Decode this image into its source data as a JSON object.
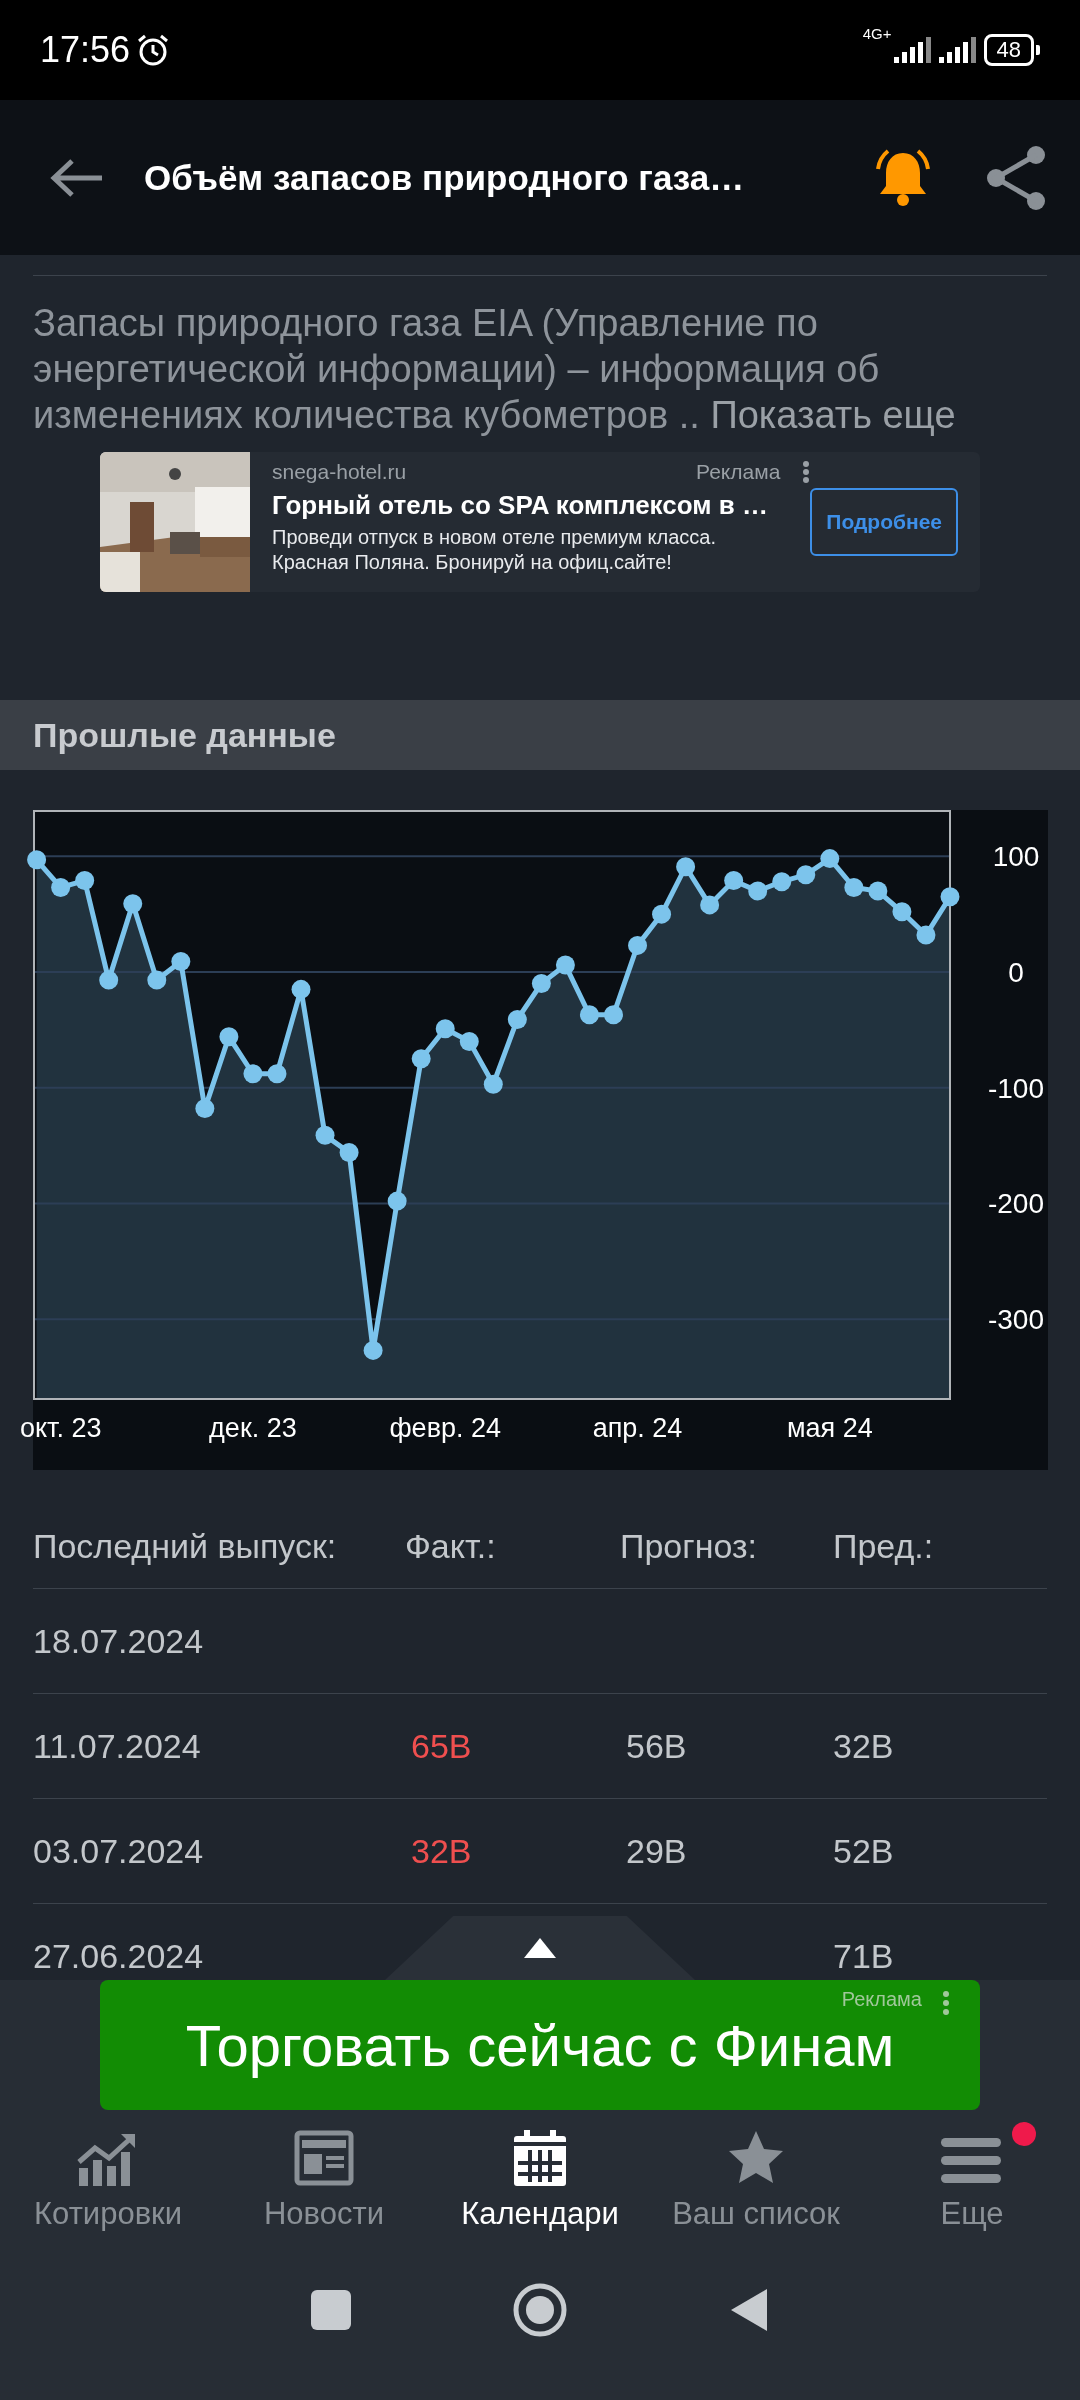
{
  "status_bar": {
    "time": "17:56",
    "network": "4G+",
    "battery": "48"
  },
  "header": {
    "title": "Объём запасов природного газа…",
    "alert_on": true
  },
  "description": {
    "text": "Запасы природного газа EIA (Управление по энергетической информации) – информация об изменениях количества кубометров ..",
    "more_link": "Показать еще"
  },
  "ad": {
    "domain": "snega-hotel.ru",
    "label": "Реклама",
    "title": "Горный отель со SPA комплексом в …",
    "text": "Проведи отпуск в новом отеле премиум класса. Красная Поляна. Бронируй на офиц.сайте!",
    "button": "Подробнее"
  },
  "section_title": "Прошлые данные",
  "chart": {
    "chart_data": {
      "type": "area",
      "categories": [
        null,
        "окт. 23",
        null,
        null,
        null,
        null,
        null,
        null,
        null,
        "дек. 23",
        null,
        null,
        null,
        null,
        null,
        null,
        null,
        "февр. 24",
        null,
        null,
        null,
        null,
        null,
        null,
        null,
        "апр. 24",
        null,
        null,
        null,
        null,
        null,
        null,
        null,
        "мая 24",
        null,
        null,
        null,
        null,
        null
      ],
      "series": [
        {
          "color": "#7cc4ec",
          "values": [
            97,
            73,
            79,
            -7,
            59,
            -7,
            9,
            -118,
            -56,
            -88,
            -88,
            -15,
            -141,
            -156,
            -327,
            -198,
            -75,
            -49,
            -60,
            -97,
            -41,
            -10,
            6,
            -37,
            -37,
            23,
            50,
            91,
            58,
            79,
            70,
            78,
            84,
            98,
            73,
            70,
            52,
            32,
            65
          ]
        }
      ],
      "ylim": [
        -369,
        140
      ],
      "yticks": [
        -300,
        -200,
        -100,
        0,
        100
      ],
      "grid": true
    }
  },
  "table": {
    "columns": [
      "Последний выпуск:",
      "Факт.:",
      "Прогноз:",
      "Пред.:"
    ],
    "rows": [
      {
        "date": "18.07.2024"
      },
      {
        "date": "11.07.2024",
        "actual": {
          "value": "65B",
          "color": "#ef4f4f"
        },
        "forecast": "56B",
        "previous": "32B"
      },
      {
        "date": "03.07.2024",
        "actual": {
          "value": "32B",
          "color": "#ef4f4f"
        },
        "forecast": "29B",
        "previous": "52B"
      },
      {
        "date": "27.06.2024",
        "previous": "71B"
      }
    ]
  },
  "banner": {
    "text": "Торговать сейчас с Финам",
    "label": "Реклама"
  },
  "tabs": [
    {
      "kind": "quotes",
      "label": "Котировки",
      "selected": false,
      "badge": false
    },
    {
      "kind": "news",
      "label": "Новости",
      "selected": false,
      "badge": false
    },
    {
      "kind": "calendar",
      "label": "Календари",
      "selected": true,
      "badge": false
    },
    {
      "kind": "watchlist",
      "label": "Ваш список",
      "selected": false,
      "badge": false
    },
    {
      "kind": "more",
      "label": "Еще",
      "selected": false,
      "badge": true
    }
  ]
}
